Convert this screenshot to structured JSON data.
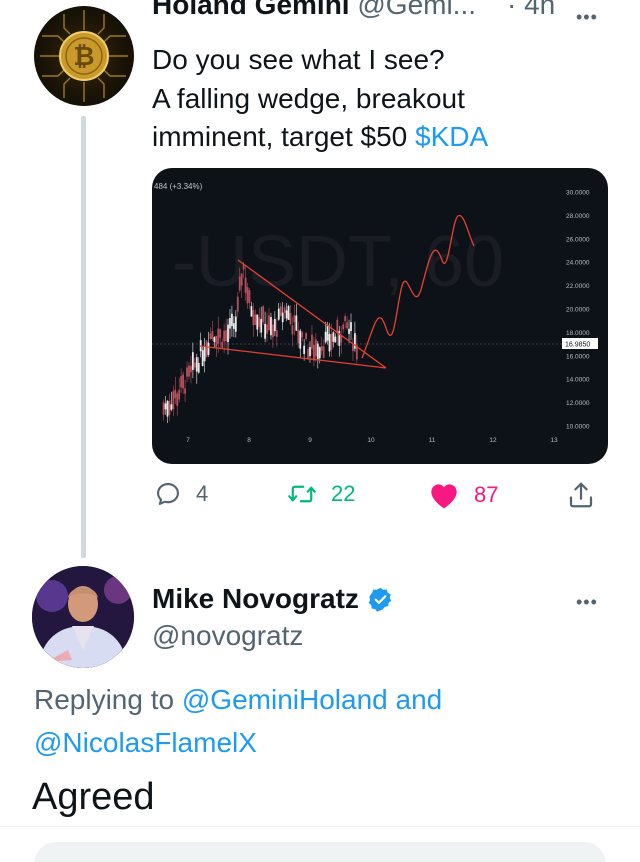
{
  "tweet1": {
    "author_name": "Holand Gemini",
    "author_handle": "@Gemi...",
    "time": "· 4h",
    "text_line1": "Do you see what I see?",
    "text_line2": "A falling wedge, breakout",
    "text_line3_prefix": "imminent, target $50 ",
    "cashtag": "$KDA",
    "chart": {
      "change_label": "484 (+3.34%)",
      "watermark": "-USDT, 60",
      "price_labels": [
        "30.0000",
        "28.0000",
        "26.0000",
        "24.0000",
        "22.0000",
        "20.0000",
        "18.0000",
        "16.0000",
        "14.0000",
        "12.0000",
        "10.0000"
      ],
      "current_price": "16.9850",
      "date_labels": [
        "7",
        "8",
        "9",
        "10",
        "11",
        "12",
        "13"
      ]
    },
    "replies": "4",
    "retweets": "22",
    "likes": "87"
  },
  "tweet2": {
    "author_name": "Mike Novogratz",
    "author_handle": "@novogratz",
    "replying_prefix": "Replying to ",
    "mention1": "@GeminiHoland",
    "and_word": " and",
    "mention2": "@NicolasFlamelX",
    "text": "Agreed"
  },
  "colors": {
    "link": "#1d9bf0",
    "retweet": "#00ba7c",
    "like": "#f91880",
    "muted": "#536471",
    "chart_bg": "#0d1118",
    "wedge": "#e8412e"
  },
  "chart_data": {
    "type": "line",
    "title": "",
    "xlabel": "",
    "ylabel": "",
    "ylim": [
      10,
      30
    ],
    "x_ticks": [
      "7",
      "8",
      "9",
      "10",
      "11",
      "12",
      "13"
    ],
    "current_price": 16.985,
    "series": [
      {
        "x": [
          6.6,
          6.8,
          7.0,
          7.2,
          7.4,
          7.6,
          7.8,
          7.9,
          8.0,
          8.2,
          8.4,
          8.6,
          8.8,
          9.0,
          9.2,
          9.4,
          9.6,
          9.8
        ],
        "values": [
          11.5,
          12.5,
          14,
          16,
          18,
          17.5,
          19,
          24,
          20.5,
          19,
          18,
          20,
          18,
          16.5,
          17,
          17.5,
          18.5,
          16.5
        ]
      }
    ]
  }
}
